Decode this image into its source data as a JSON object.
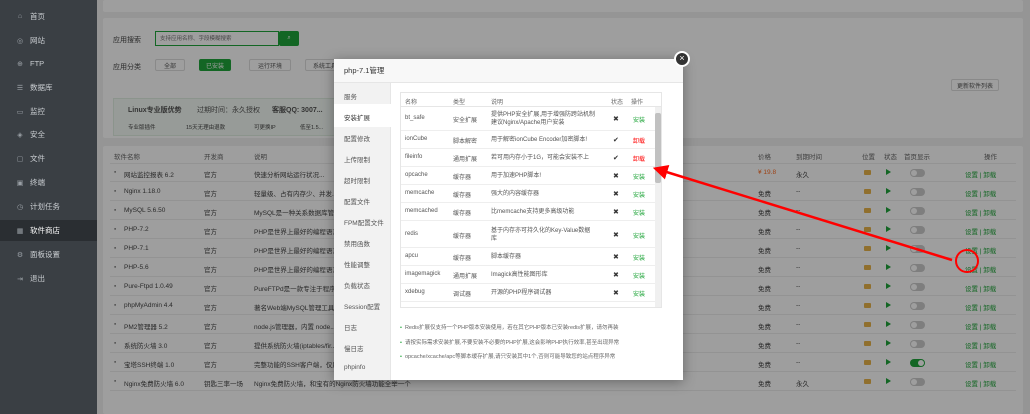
{
  "sidebar": {
    "items": [
      {
        "label": "首页",
        "icon": "home-icon"
      },
      {
        "label": "网站",
        "icon": "globe-icon"
      },
      {
        "label": "FTP",
        "icon": "ftp-icon"
      },
      {
        "label": "数据库",
        "icon": "database-icon"
      },
      {
        "label": "监控",
        "icon": "monitor-icon"
      },
      {
        "label": "安全",
        "icon": "shield-icon"
      },
      {
        "label": "文件",
        "icon": "folder-icon"
      },
      {
        "label": "终端",
        "icon": "terminal-icon"
      },
      {
        "label": "计划任务",
        "icon": "clock-icon"
      },
      {
        "label": "软件商店",
        "icon": "store-icon",
        "active": true
      },
      {
        "label": "面板设置",
        "icon": "gear-icon"
      },
      {
        "label": "退出",
        "icon": "logout-icon"
      }
    ]
  },
  "toolbar": {
    "search_label": "应用搜索",
    "search_placeholder": "支持应用名称、字段模糊搜索",
    "category_label": "应用分类",
    "categories": [
      "全部",
      "已安装",
      "运行环境",
      "系统工具"
    ],
    "update_list_btn": "更新软件列表"
  },
  "banner": {
    "title": "Linux专业版优势",
    "expire": "过期时间：永久授权",
    "qq": "客服QQ: 3007...",
    "benefits": [
      "专业版插件",
      "15天无理由退款",
      "可更换IP",
      "低至1.5..."
    ]
  },
  "table": {
    "headers": [
      "软件名称",
      "开发商",
      "说明",
      "价格",
      "到期时间",
      "位置",
      "状态",
      "首页显示",
      "操作"
    ],
    "rows": [
      {
        "name": "网站监控报表 6.2",
        "dev": "官方",
        "desc": "快速分析网站运行状况...",
        "price": "¥ 19.8",
        "expire": "永久",
        "show": false,
        "ops": "设置 | 卸载"
      },
      {
        "name": "Nginx 1.18.0",
        "dev": "官方",
        "desc": "轻量级、占有内存少、并发...",
        "price": "免费",
        "expire": "--",
        "show": false,
        "ops": "设置 | 卸载"
      },
      {
        "name": "MySQL 5.6.50",
        "dev": "官方",
        "desc": "MySQL是一种关系数据库管理...",
        "price": "免费",
        "expire": "--",
        "show": false,
        "ops": "设置 | 卸载"
      },
      {
        "name": "PHP-7.2",
        "dev": "官方",
        "desc": "PHP是世界上最好的编程语言...",
        "price": "免费",
        "expire": "--",
        "show": false,
        "ops": "设置 | 卸载"
      },
      {
        "name": "PHP-7.1",
        "dev": "官方",
        "desc": "PHP是世界上最好的编程语言...",
        "price": "免费",
        "expire": "--",
        "show": false,
        "ops": "设置 | 卸载"
      },
      {
        "name": "PHP-5.6",
        "dev": "官方",
        "desc": "PHP是世界上最好的编程语言...",
        "price": "免费",
        "expire": "--",
        "show": false,
        "ops": "设置 | 卸载"
      },
      {
        "name": "Pure-Ftpd 1.0.49",
        "dev": "官方",
        "desc": "PureFTPd是一款专注于程序...",
        "price": "免费",
        "expire": "--",
        "show": false,
        "ops": "设置 | 卸载"
      },
      {
        "name": "phpMyAdmin 4.4",
        "dev": "官方",
        "desc": "著名Web端MySQL管理工具...",
        "price": "免费",
        "expire": "--",
        "show": false,
        "ops": "设置 | 卸载"
      },
      {
        "name": "PM2管理器 5.2",
        "dev": "官方",
        "desc": "node.js管理器，内置 node...",
        "price": "免费",
        "expire": "--",
        "show": false,
        "ops": "设置 | 卸载"
      },
      {
        "name": "系统防火墙 3.0",
        "dev": "官方",
        "desc": "提供系统防火墙(iptables/fir...",
        "price": "免费",
        "expire": "--",
        "show": false,
        "ops": "设置 | 卸载"
      },
      {
        "name": "宝塔SSH终端 1.0",
        "dev": "官方",
        "desc": "完整功能的SSH客户端，仅用于连接本服务器",
        "price": "免费",
        "expire": "--",
        "show": true,
        "ops": "设置 | 卸载"
      },
      {
        "name": "Nginx免费防火墙 6.0",
        "dev": "钥匙三率一场",
        "desc": "Nginx免费防火墙，和宝有的Nginx防火墙功能全举一个",
        "price": "免费",
        "expire": "永久",
        "show": false,
        "ops": "设置 | 卸载"
      }
    ]
  },
  "modal": {
    "title": "php-7.1管理",
    "close": "×",
    "tabs": [
      "服务",
      "安装扩展",
      "配置修改",
      "上传限制",
      "超时限制",
      "配置文件",
      "FPM配置文件",
      "禁用函数",
      "性能调整",
      "负载状态",
      "Session配置",
      "日志",
      "慢日志",
      "phpinfo"
    ],
    "active_tab": 1,
    "ext_headers": [
      "名称",
      "类型",
      "说明",
      "状态",
      "操作"
    ],
    "extensions": [
      {
        "name": "bt_safe",
        "type": "安全扩展",
        "desc": "提供PHP安全扩展,用于增强防跨站机制建议Nginx/Apache用户安装",
        "status": "x",
        "action": "安装"
      },
      {
        "name": "ionCube",
        "type": "脚本解密",
        "desc": "用于解密ionCube Encoder加密脚本!",
        "status": "check",
        "action": "卸载"
      },
      {
        "name": "fileinfo",
        "type": "通用扩展",
        "desc": "若可用内存小于1G，可能会安装不上",
        "status": "check",
        "action": "卸载"
      },
      {
        "name": "opcache",
        "type": "缓存器",
        "desc": "用于加速PHP脚本!",
        "status": "x",
        "action": "安装"
      },
      {
        "name": "memcache",
        "type": "缓存器",
        "desc": "强大的内容缓存器",
        "status": "x",
        "action": "安装"
      },
      {
        "name": "memcached",
        "type": "缓存器",
        "desc": "比memcache支持更多高级功能",
        "status": "x",
        "action": "安装"
      },
      {
        "name": "redis",
        "type": "缓存器",
        "desc": "基于内存亦可持久化的Key-Value数据库",
        "status": "x",
        "action": "安装"
      },
      {
        "name": "apcu",
        "type": "缓存器",
        "desc": "脚本缓存器",
        "status": "x",
        "action": "安装"
      },
      {
        "name": "imagemagick",
        "type": "通用扩展",
        "desc": "Imagick高性能图形库",
        "status": "x",
        "action": "安装"
      },
      {
        "name": "xdebug",
        "type": "调试器",
        "desc": "开源的PHP程序调试器",
        "status": "x",
        "action": "安装"
      }
    ],
    "notes": [
      "Redis扩展仅支持一个PHP版本安装使用，若在其它PHP版本已安装redis扩展，请勿再装",
      "请按实际需求安装扩展,不要安装不必要的PHP扩展,这会影响PHP执行效率,甚至出现异常",
      "opcache/xcache/apc等脚本缓存扩展,请只安装其中1个,否则可能导致您的站点程序异常"
    ]
  },
  "colors": {
    "accent": "#20a53a",
    "danger": "#ff0000",
    "sidebar": "#3a3f44"
  }
}
